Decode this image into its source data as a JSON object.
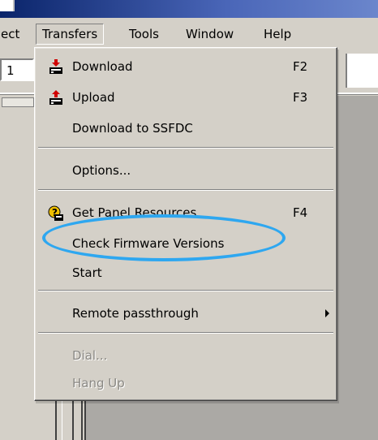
{
  "menubar": {
    "items": [
      "ect",
      "Transfers",
      "Tools",
      "Window",
      "Help"
    ],
    "active": "Transfers"
  },
  "field_value": "1",
  "dropdown": {
    "items": [
      {
        "label": "Download",
        "shortcut": "F2",
        "icon": "download-icon",
        "enabled": true
      },
      {
        "label": "Upload",
        "shortcut": "F3",
        "icon": "upload-icon",
        "enabled": true
      },
      {
        "label": "Download to SSFDC",
        "shortcut": "",
        "icon": "",
        "enabled": true
      },
      {
        "label": "Options...",
        "shortcut": "",
        "icon": "",
        "enabled": true
      },
      {
        "label": "Get Panel Resources",
        "shortcut": "F4",
        "icon": "panel-resources-icon",
        "enabled": true
      },
      {
        "label": "Check Firmware Versions",
        "shortcut": "",
        "icon": "",
        "enabled": true,
        "highlighted": true
      },
      {
        "label": "Start",
        "shortcut": "",
        "icon": "",
        "enabled": true
      },
      {
        "label": "Remote passthrough",
        "shortcut": "",
        "icon": "submenu-arrow-icon",
        "enabled": true
      },
      {
        "label": "Dial...",
        "shortcut": "",
        "icon": "",
        "enabled": false
      },
      {
        "label": "Hang Up",
        "shortcut": "",
        "icon": "",
        "enabled": false
      }
    ]
  },
  "colors": {
    "highlight_ellipse": "#2ea7f0",
    "menu_bg": "#d4d0c8",
    "titlebar": "#0a246a"
  }
}
